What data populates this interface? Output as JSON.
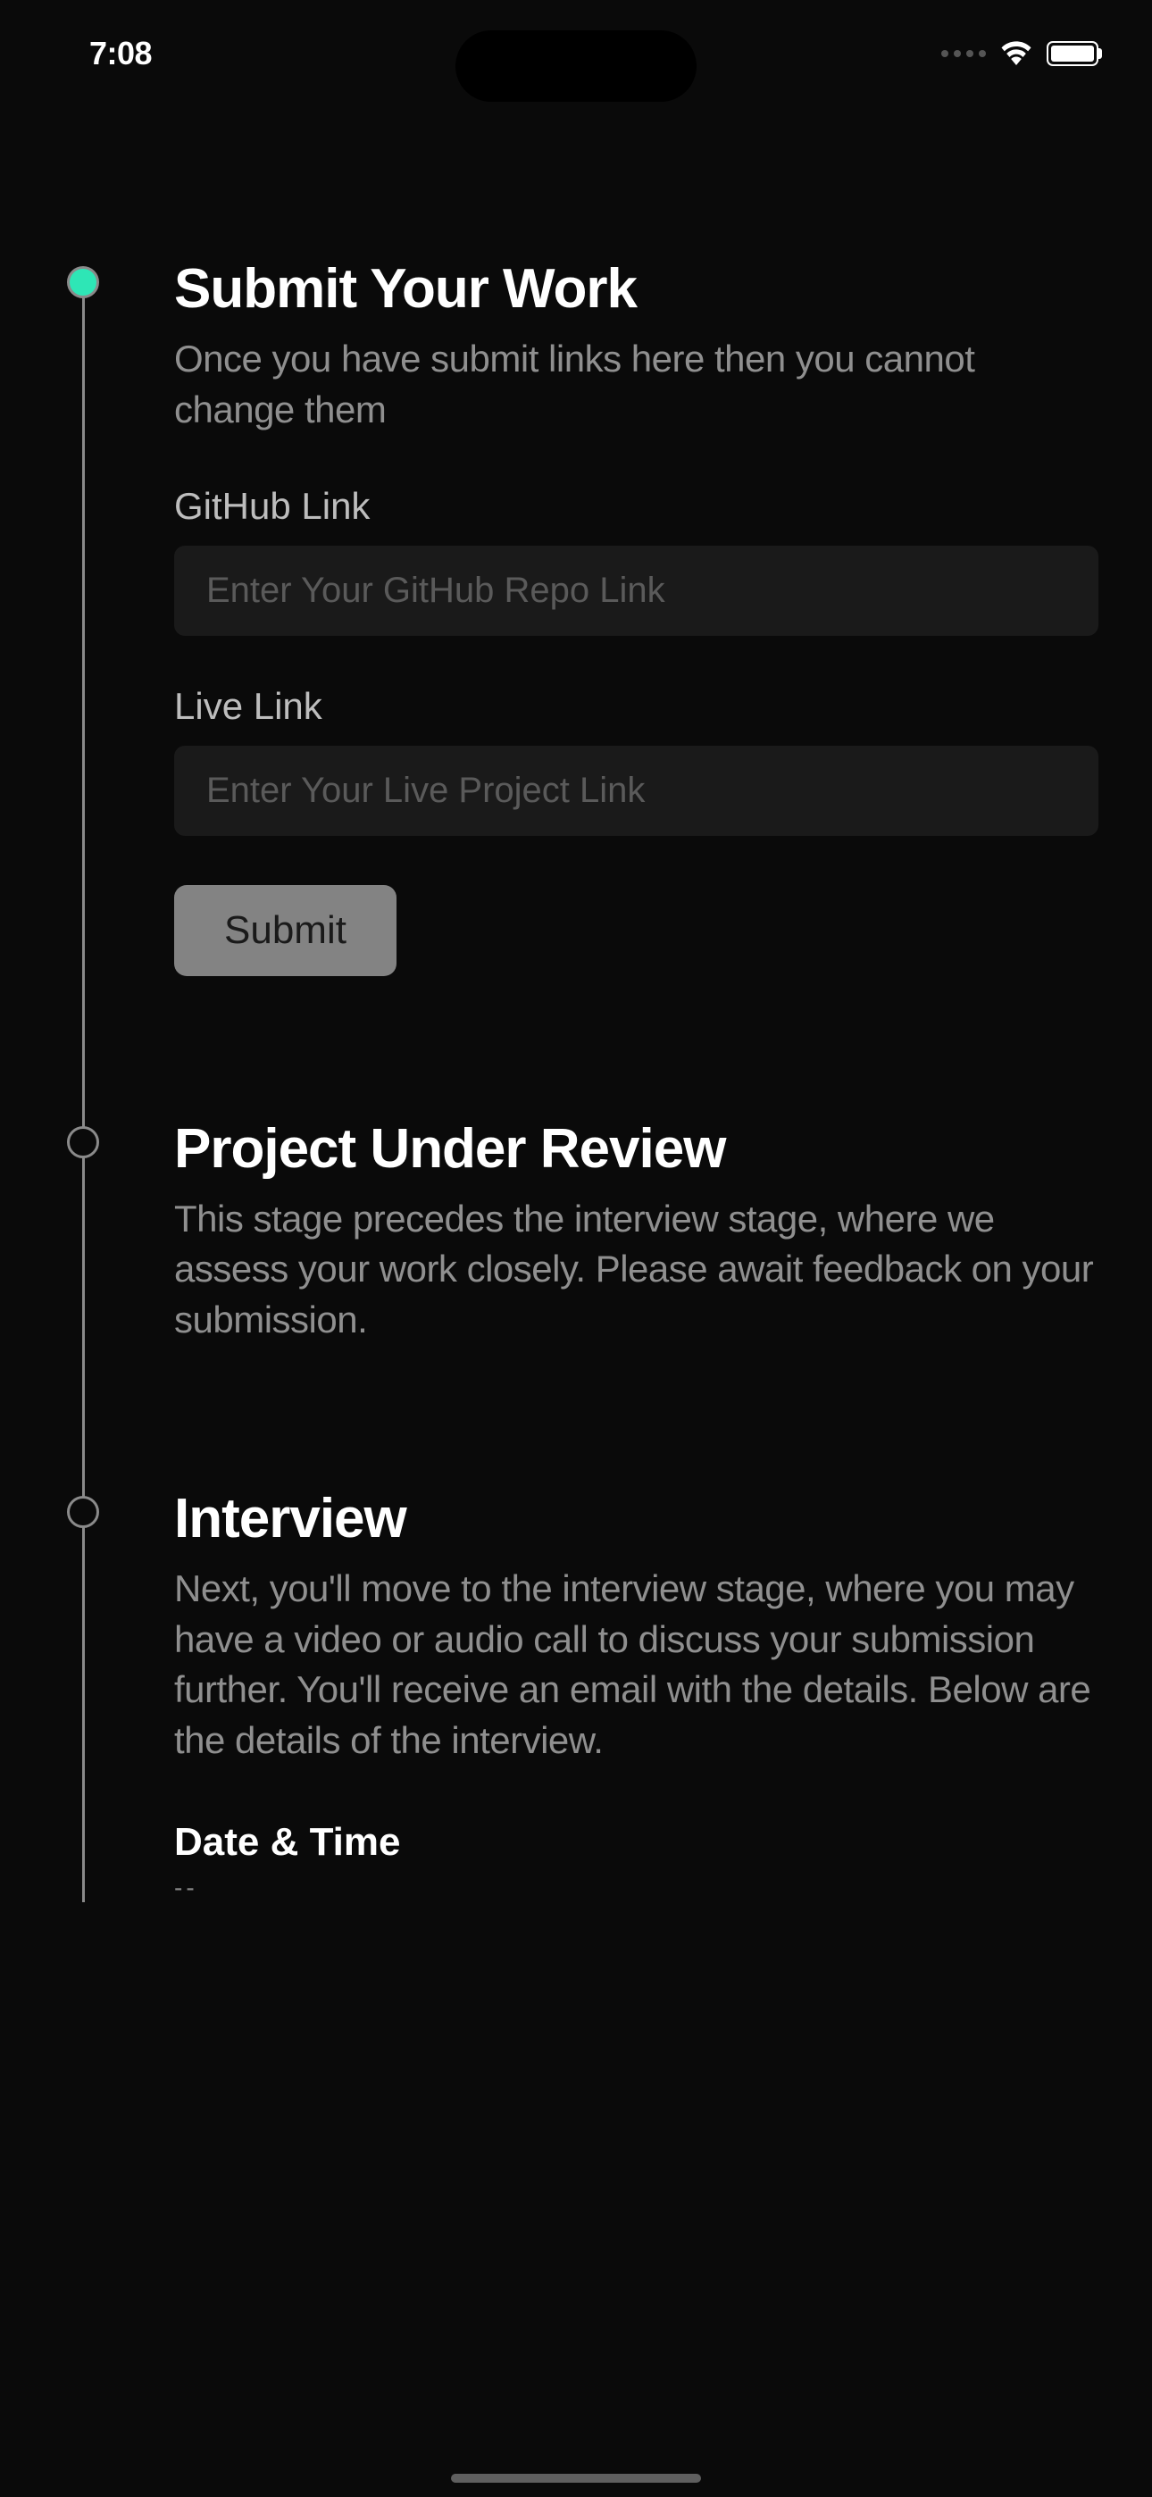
{
  "statusBar": {
    "time": "7:08"
  },
  "steps": [
    {
      "title": "Submit Your Work",
      "description": "Once you have submit links here then you cannot change them",
      "active": true,
      "form": {
        "github": {
          "label": "GitHub Link",
          "placeholder": "Enter Your GitHub Repo Link"
        },
        "live": {
          "label": "Live Link",
          "placeholder": "Enter Your Live Project Link"
        },
        "submitLabel": "Submit"
      }
    },
    {
      "title": "Project Under Review",
      "description": "This stage precedes the interview stage, where we assess your work closely. Please await feedback on your submission.",
      "active": false
    },
    {
      "title": "Interview",
      "description": "Next, you'll move to the interview stage, where you may have a video or audio call to discuss your submission further. You'll receive an email with the details. Below are the details of the interview.",
      "active": false,
      "detail": {
        "label": "Date & Time",
        "value": "--"
      }
    }
  ]
}
